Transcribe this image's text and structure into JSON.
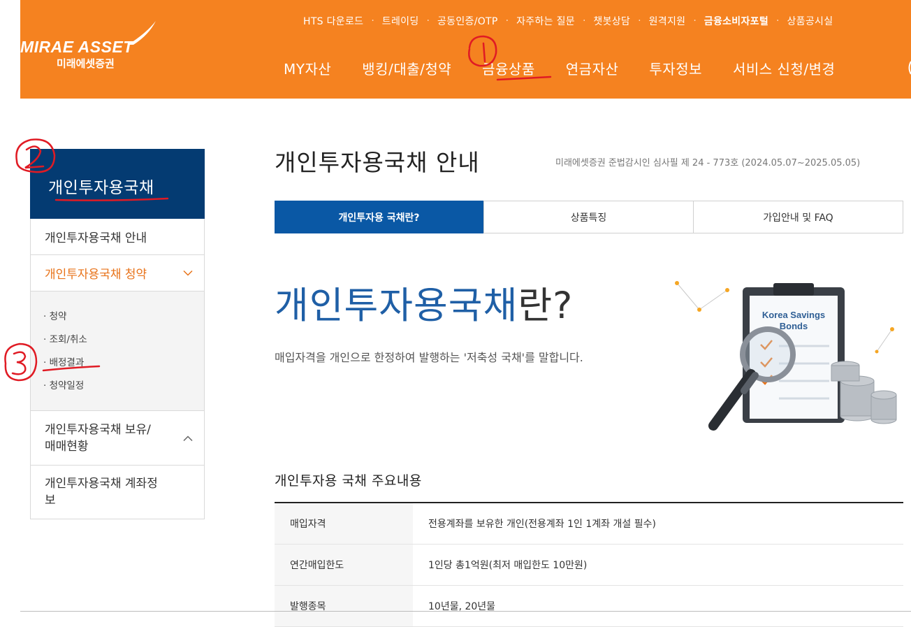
{
  "brand": {
    "name_en": "MIRAE ASSET",
    "name_ko": "미래에셋증권"
  },
  "utility_nav": [
    {
      "label": "HTS 다운로드",
      "bold": false
    },
    {
      "label": "트레이딩",
      "bold": false
    },
    {
      "label": "공동인증/OTP",
      "bold": false
    },
    {
      "label": "자주하는 질문",
      "bold": false
    },
    {
      "label": "챗봇상담",
      "bold": false
    },
    {
      "label": "원격지원",
      "bold": false
    },
    {
      "label": "금융소비자포털",
      "bold": true
    },
    {
      "label": "상품공시실",
      "bold": false
    }
  ],
  "main_nav": [
    "MY자산",
    "뱅킹/대출/청약",
    "금융상품",
    "연금자산",
    "투자정보",
    "서비스 신청/변경"
  ],
  "sidebar": {
    "title": "개인투자용국채",
    "items": [
      {
        "label": "개인투자용국채 안내"
      },
      {
        "label": "개인투자용국채 청약",
        "active": true,
        "expanded": true
      },
      {
        "label": "개인투자용국채 보유/\n매매현황",
        "expanded": false
      },
      {
        "label": "개인투자용국채 계좌정\n보"
      }
    ],
    "subitems": [
      "· 청약",
      "· 조회/취소",
      "· 배정결과",
      "· 청약일정"
    ]
  },
  "page": {
    "title": "개인투자용국채 안내",
    "review_note": "미래에셋증권 준법감시인 심사필 제 24 - 773호 (2024.05.07~2025.05.05)"
  },
  "tabs": [
    {
      "label": "개인투자용 국채란?",
      "active": true
    },
    {
      "label": "상품특징",
      "active": false
    },
    {
      "label": "가입안내 및 FAQ",
      "active": false
    }
  ],
  "hero": {
    "title_main": "개인투자용국채",
    "title_suffix": "란?",
    "description": "매입자격을 개인으로 한정하여 발행하는 '저축성 국채'를 말합니다.",
    "illustration_text_1": "Korea Savings",
    "illustration_text_2": "Bonds"
  },
  "summary": {
    "title": "개인투자용 국채 주요내용",
    "rows": [
      {
        "label": "매입자격",
        "value": "전용계좌를 보유한 개인(전용계좌 1인 1계좌 개설 필수)"
      },
      {
        "label": "연간매입한도",
        "value": "1인당 총1억원(최저 매입한도 10만원)"
      },
      {
        "label": "발행종목",
        "value": "10년물, 20년물"
      }
    ]
  },
  "annotations": [
    "1",
    "2",
    "3"
  ],
  "colors": {
    "header_orange": "#f58220",
    "sidebar_navy": "#043b72",
    "tab_blue": "#0a58a5",
    "active_orange": "#e8731a",
    "annotation_red": "#e01b24"
  }
}
